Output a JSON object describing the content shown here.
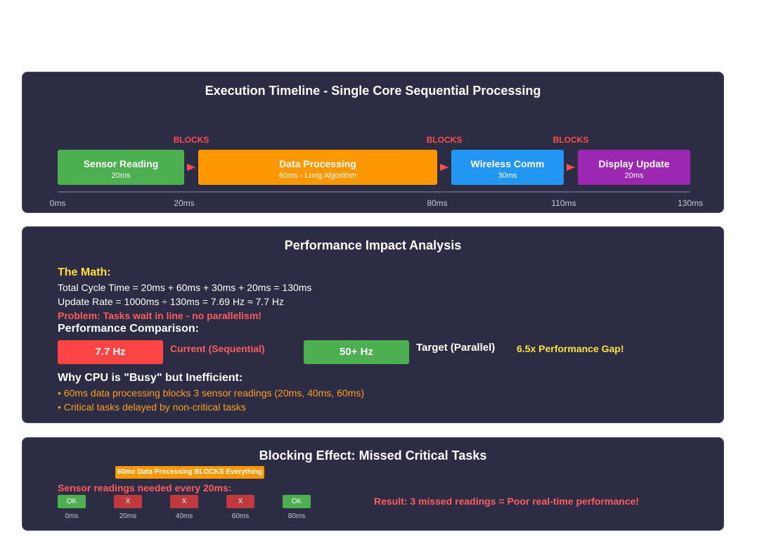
{
  "timeline": {
    "title": "Execution Timeline - Single Core Sequential Processing",
    "blocks_label": "BLOCKS",
    "tasks": [
      {
        "name": "Sensor Reading",
        "detail": "20ms",
        "color": "#4caf50"
      },
      {
        "name": "Data Processing",
        "detail": "60ms - Long Algorithm",
        "color": "#ff9800"
      },
      {
        "name": "Wireless Comm",
        "detail": "30ms",
        "color": "#2196f3"
      },
      {
        "name": "Display Update",
        "detail": "20ms",
        "color": "#9c27b0"
      }
    ],
    "ticks": [
      "0ms",
      "20ms",
      "80ms",
      "110ms",
      "130ms"
    ]
  },
  "analysis": {
    "title": "Performance Impact Analysis",
    "math_heading": "The Math:",
    "cycle_line": "Total Cycle Time = 20ms + 60ms + 30ms + 20ms = 130ms",
    "rate_line": "Update Rate = 1000ms ÷ 130ms = 7.69 Hz ≈ 7.7 Hz",
    "problem": "Problem: Tasks wait in line - no parallelism!",
    "comparison_heading": "Performance Comparison:",
    "current_value": "7.7 Hz",
    "current_label": "Current (Sequential)",
    "target_value": "50+ Hz",
    "target_label": "Target (Parallel)",
    "gap": "6.5x Performance Gap!",
    "why_heading": "Why CPU is \"Busy\" but Inefficient:",
    "bullets": [
      "• 60ms data processing blocks 3 sensor readings (20ms, 40ms, 60ms)",
      "• Critical tasks delayed by non-critical tasks"
    ]
  },
  "blocking": {
    "title": "Blocking Effect: Missed Critical Tasks",
    "banner": "60ms Data Processing BLOCKS Everything",
    "needed": "Sensor readings needed every 20ms:",
    "readings": [
      {
        "status": "OK",
        "time": "0ms"
      },
      {
        "status": "X",
        "time": "20ms"
      },
      {
        "status": "X",
        "time": "40ms"
      },
      {
        "status": "X",
        "time": "60ms"
      },
      {
        "status": "OK",
        "time": "80ms"
      }
    ],
    "result": "Result: 3 missed readings = Poor real-time performance!"
  }
}
